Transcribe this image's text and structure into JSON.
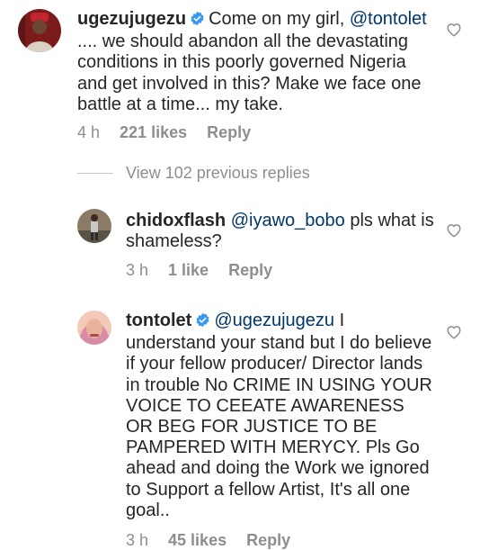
{
  "comments": [
    {
      "username": "ugezujugezu",
      "verified": true,
      "mention": "@tontolet",
      "text_pre": "Come on my girl, ",
      "text_post": " .... we should abandon all the devastating conditions in this poorly governed Nigeria and get involved in this? Make we face one battle at a time... my take.",
      "time": "4 h",
      "likes": "221 likes",
      "reply_label": "Reply"
    },
    {
      "username": "chidoxflash",
      "verified": false,
      "mention": "@iyawo_bobo",
      "text_pre": "",
      "text_post": " pls what is shameless?",
      "time": "3 h",
      "likes": "1 like",
      "reply_label": "Reply"
    },
    {
      "username": "tontolet",
      "verified": true,
      "mention": "@ugezujugezu",
      "text_pre": "",
      "text_post": " I understand your stand but I do believe if your fellow producer/ Director lands in trouble No CRIME IN USING YOUR VOICE TO CEEATE AWARENESS OR BEG FOR JUSTICE TO BE PAMPERED WITH MERYCY. Pls Go ahead and doing the Work we ignored to Support a fellow Artist, It's all one goal..",
      "time": "3 h",
      "likes": "45 likes",
      "reply_label": "Reply"
    }
  ],
  "view_replies_label": "View 102 previous replies",
  "colors": {
    "text": "#262626",
    "muted": "#8e8e8e",
    "mention": "#00376b",
    "verified": "#3897f0"
  },
  "icons": {
    "like": "heart-outline-icon",
    "verified": "verified-badge-icon"
  }
}
